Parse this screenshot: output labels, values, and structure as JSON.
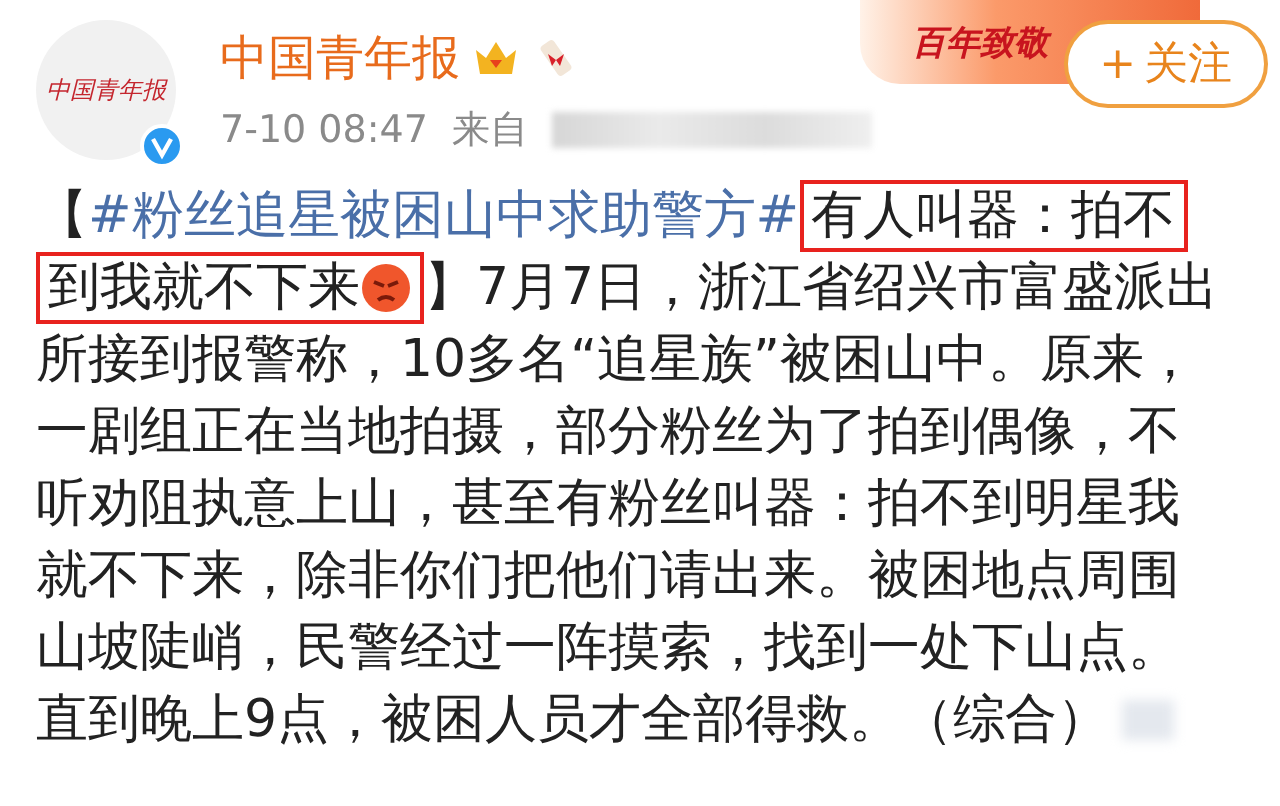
{
  "author": {
    "avatar_text": "中国青年报",
    "name": "中国青年报",
    "verified": true,
    "time": "7-10 08:47",
    "source_label": "来自"
  },
  "banner": {
    "text": "百年致敬"
  },
  "follow_button": {
    "icon": "+",
    "label": "关注"
  },
  "post": {
    "lines": [
      [
        {
          "kind": "plain",
          "text": "【"
        },
        {
          "kind": "hashtag",
          "text": "#粉丝追星被困山中求助警方#"
        },
        {
          "kind": "boxed",
          "text": "有人叫器：拍不"
        }
      ],
      [
        {
          "kind": "boxed",
          "text": "到我就不下来",
          "emoji": true
        },
        {
          "kind": "plain",
          "text": "】7月7日，浙江省绍兴市富盛派出"
        }
      ],
      [
        {
          "kind": "plain",
          "text": "所接到报警称，10多名“追星族”被困山中。原来，"
        }
      ],
      [
        {
          "kind": "plain",
          "text": "一剧组正在当地拍摄，部分粉丝为了拍到偶像，不"
        }
      ],
      [
        {
          "kind": "plain",
          "text": "听劝阻执意上山，甚至有粉丝叫器：拍不到明星我"
        }
      ],
      [
        {
          "kind": "plain",
          "text": "就不下来，除非你们把他们请出来。被困地点周围"
        }
      ],
      [
        {
          "kind": "plain",
          "text": "山坡陡峭，民警经过一阵摸索，找到一处下山点。"
        }
      ],
      [
        {
          "kind": "plain",
          "text": "直到晚上9点，被困人员才全部得救。（综合）"
        }
      ]
    ]
  }
}
